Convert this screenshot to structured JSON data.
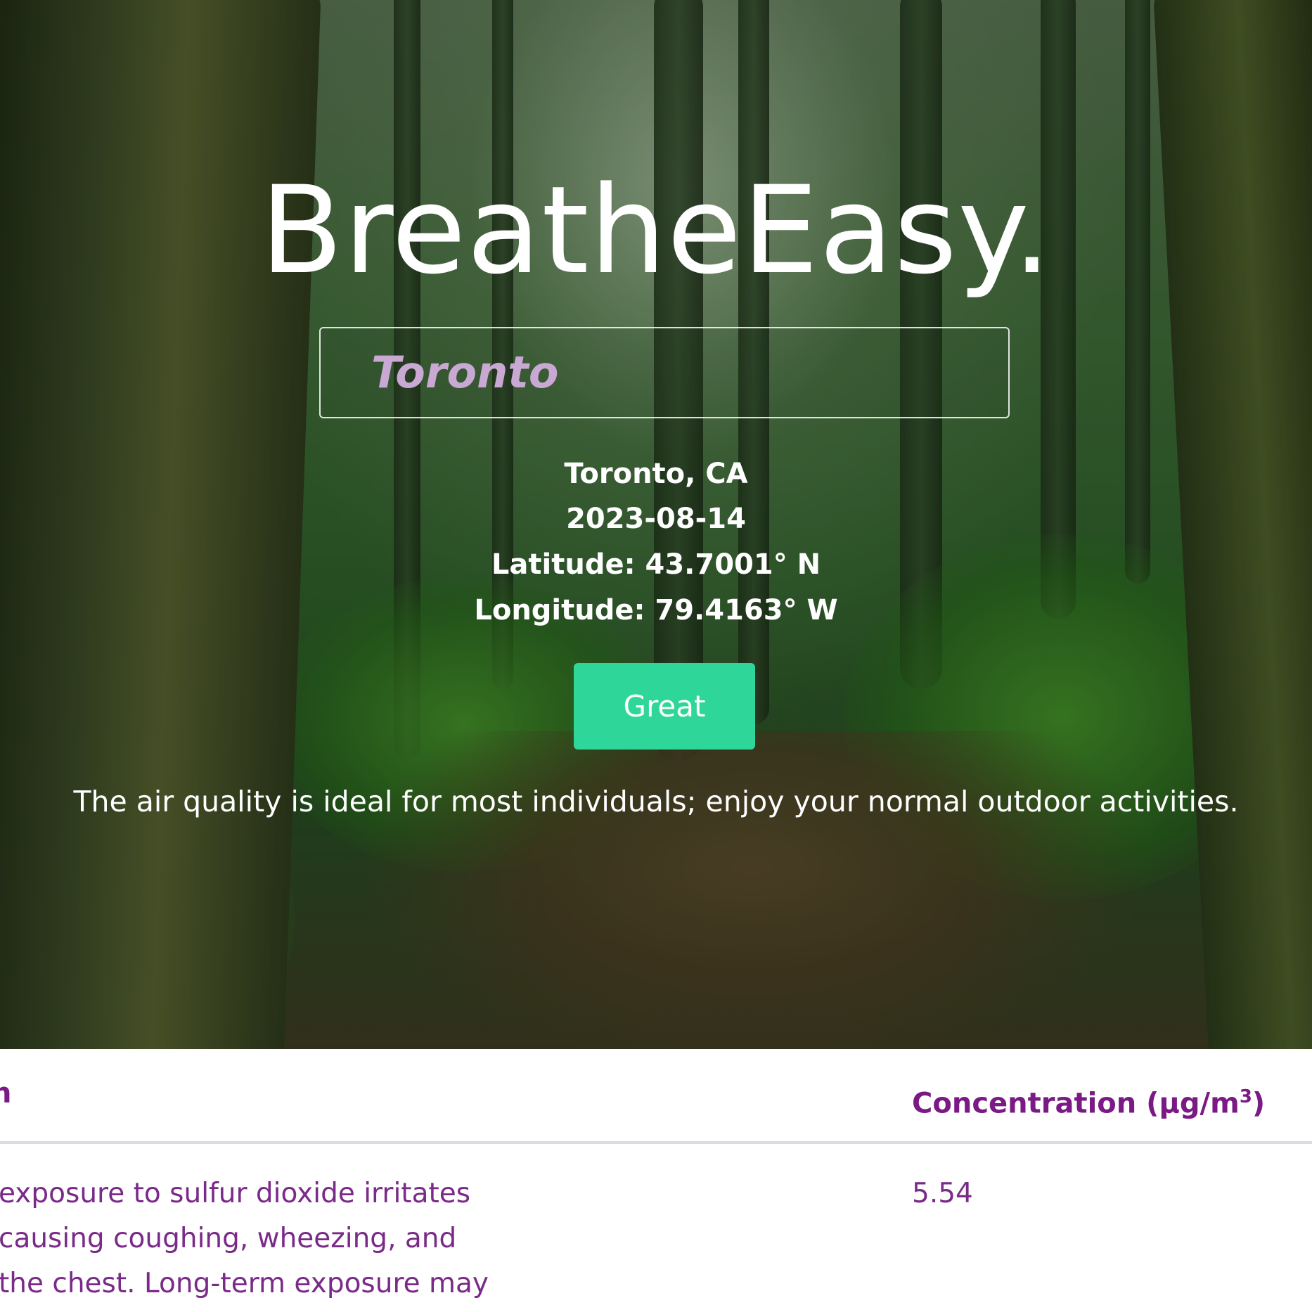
{
  "app": {
    "brand": "BreatheEasy."
  },
  "search": {
    "value": "Toronto"
  },
  "location": {
    "city": "Toronto, CA",
    "date": "2023-08-14",
    "latitude": "Latitude: 43.7001° N",
    "longitude": "Longitude: 79.4163° W"
  },
  "air_quality": {
    "rating": "Great",
    "rating_color": "#2fd699",
    "advice": "The air quality is ideal for most individuals; enjoy your normal outdoor activities."
  },
  "table": {
    "header_left_partial": "n",
    "header_concentration": "Concentration (µg/m",
    "header_concentration_sup": "3",
    "header_concentration_close": ")",
    "row": {
      "description_lines": [
        "exposure to sulfur dioxide irritates",
        " causing coughing, wheezing, and",
        " the chest. Long-term exposure may"
      ],
      "concentration": "5.54"
    }
  },
  "colors": {
    "accent_purple": "#7a1a85",
    "placeholder_lilac": "#c9a9d3"
  }
}
